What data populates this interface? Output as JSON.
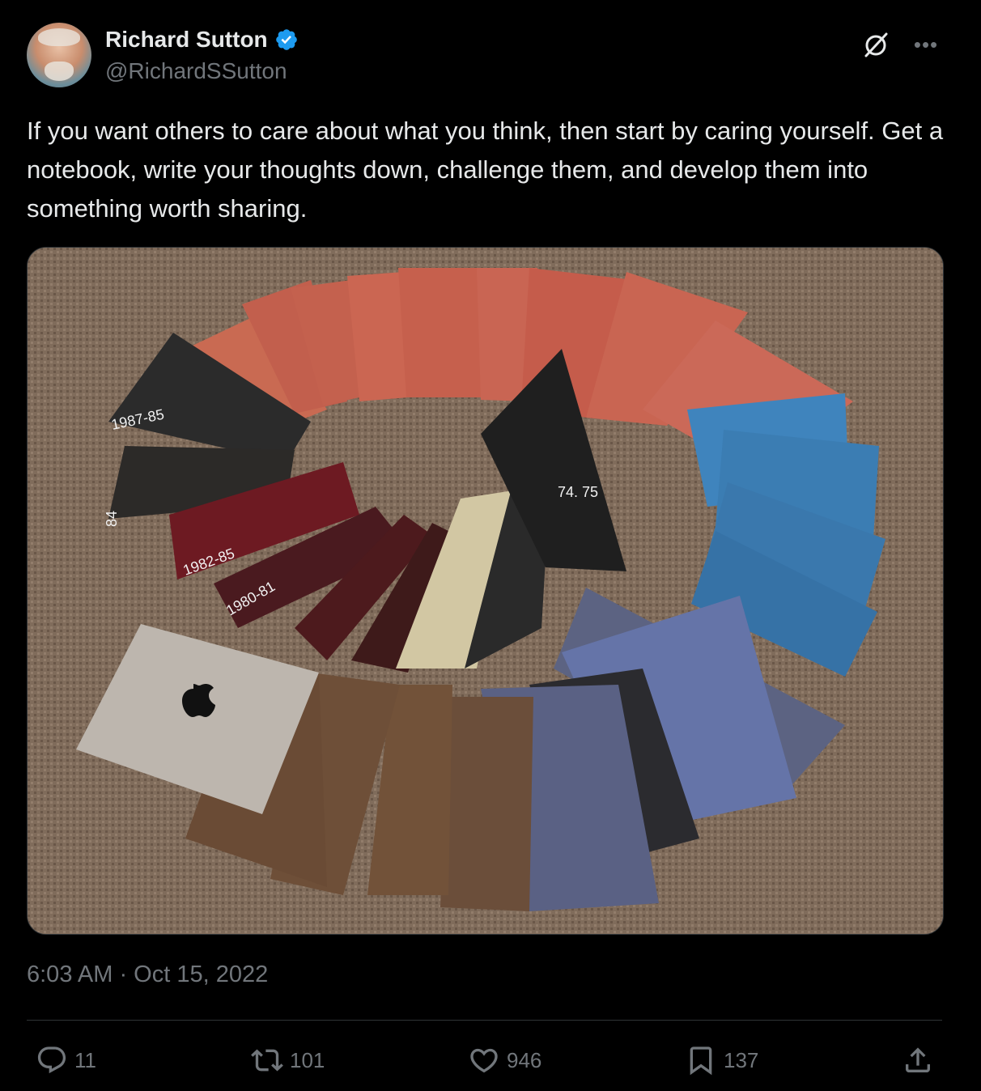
{
  "author": {
    "name": "Richard Sutton",
    "handle": "@RichardSSutton",
    "verified": true
  },
  "tweet": {
    "text": "If you want others to care about what you think, then start by caring yourself. Get a notebook, write your thoughts down, challenge them, and develop them into something worth sharing.",
    "timestamp": "6:03 AM · Oct 15, 2022"
  },
  "media": {
    "alt": "Photo of many notebooks arranged in a spiral on carpet, with a laptop",
    "spine_labels": [
      "1987-85",
      "84",
      "1982-85",
      "1980-81",
      "74. 75"
    ]
  },
  "actions": {
    "reply_count": "11",
    "retweet_count": "101",
    "like_count": "946",
    "bookmark_count": "137"
  },
  "icons": {
    "verified": "verified-badge-icon",
    "grok": "grok-icon",
    "more": "more-icon",
    "reply": "reply-icon",
    "retweet": "retweet-icon",
    "like": "like-icon",
    "bookmark": "bookmark-icon",
    "share": "share-icon"
  },
  "colors": {
    "background": "#000000",
    "text": "#e7e9ea",
    "secondary": "#71767b",
    "verified": "#1d9bf0",
    "divider": "#2f3336"
  }
}
